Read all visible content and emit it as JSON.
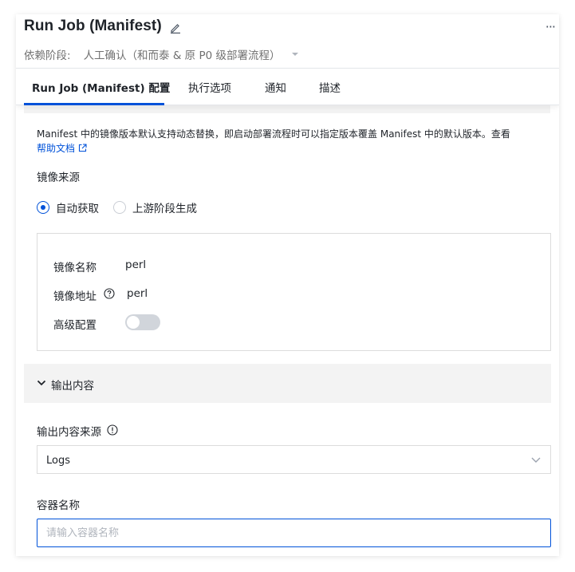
{
  "header": {
    "title": "Run Job (Manifest)",
    "more": "···",
    "stage_label": "依赖阶段:",
    "stage_value": "人工确认（和而泰 & 原 P0 级部署流程）"
  },
  "tabs": [
    {
      "label": "Run Job (Manifest) 配置",
      "active": true
    },
    {
      "label": "执行选项",
      "active": false
    },
    {
      "label": "通知",
      "active": false
    },
    {
      "label": "描述",
      "active": false
    }
  ],
  "description": {
    "text": "Manifest 中的镜像版本默认支持动态替换，即启动部署流程时可以指定版本覆盖 Manifest 中的默认版本。查看",
    "link": "帮助文档"
  },
  "image_source": {
    "label": "镜像来源",
    "options": [
      {
        "label": "自动获取",
        "checked": true
      },
      {
        "label": "上游阶段生成",
        "checked": false
      }
    ]
  },
  "image_box": {
    "name_label": "镜像名称",
    "name_value": "perl",
    "address_label": "镜像地址",
    "address_value": "perl",
    "advanced_label": "高级配置",
    "advanced_enabled": false
  },
  "output": {
    "section_title": "输出内容",
    "source_label": "输出内容来源",
    "source_value": "Logs",
    "container_label": "容器名称",
    "container_placeholder": "请输入容器名称"
  },
  "colors": {
    "accent": "#0052d9",
    "border": "#dcdcdc",
    "muted_bg": "#f3f3f3"
  }
}
